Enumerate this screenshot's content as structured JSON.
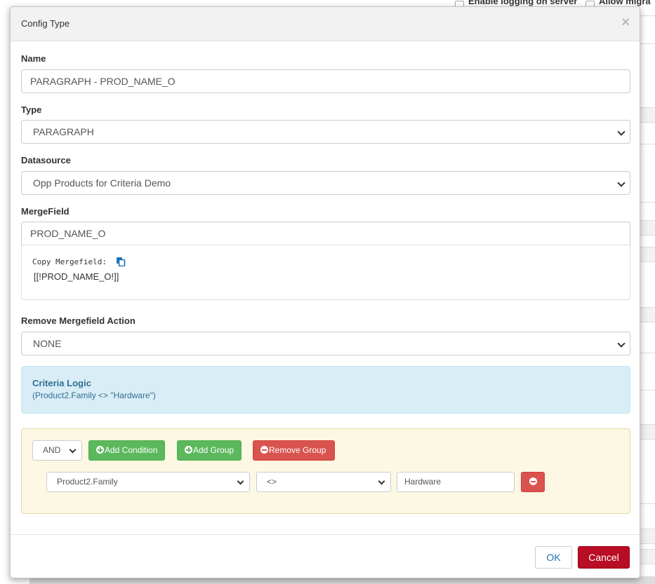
{
  "background": {
    "option_logging": "Enable logging on server",
    "option_migration": "Allow migra"
  },
  "modal": {
    "title": "Config Type",
    "close_glyph": "×"
  },
  "form": {
    "name": {
      "label": "Name",
      "value": "PARAGRAPH - PROD_NAME_O"
    },
    "type": {
      "label": "Type",
      "value": "PARAGRAPH"
    },
    "datasource": {
      "label": "Datasource",
      "value": "Opp Products for Criteria Demo"
    },
    "mergefield": {
      "label": "MergeField",
      "value": "PROD_NAME_O",
      "copy_label": "Copy Mergefield:",
      "copy_value": "[[!PROD_NAME_O!]]"
    },
    "remove_action": {
      "label": "Remove Mergefield Action",
      "value": "NONE"
    }
  },
  "criteria": {
    "title": "Criteria Logic",
    "expression": "(Product2.Family <> \"Hardware\")"
  },
  "group": {
    "operator": "AND",
    "add_condition": "Add Condition",
    "add_group": "Add Group",
    "remove_group": "Remove Group",
    "condition": {
      "field": "Product2.Family",
      "comparator": "<>",
      "value": "Hardware"
    }
  },
  "footer": {
    "ok": "OK",
    "cancel": "Cancel"
  },
  "colors": {
    "success": "#5cb85c",
    "danger": "#d9534f",
    "cancel": "#b80d24",
    "info_bg": "#d9edf7",
    "warning_bg": "#fcf8e3"
  }
}
